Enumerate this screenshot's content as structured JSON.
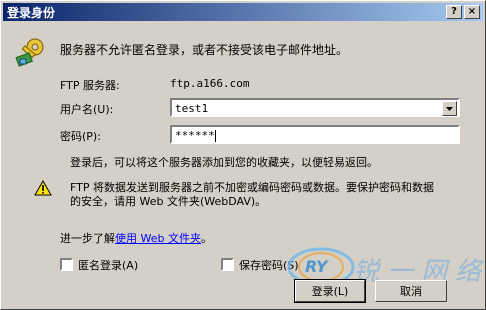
{
  "dialog": {
    "title": "登录身份",
    "help_button": "?",
    "close_button": "×"
  },
  "message": "服务器不允许匿名登录，或者不接受该电子邮件地址。",
  "ftp_server": {
    "label": "FTP 服务器:",
    "value": "ftp.a166.com"
  },
  "username": {
    "label": "用户名(U):",
    "value": "test1"
  },
  "password": {
    "label": "密码(P):",
    "value": "******"
  },
  "info_after_login": "登录后，可以将这个服务器添加到您的收藏夹，以便轻易返回。",
  "warning": {
    "line1": "FTP 将数据发送到服务器之前不加密或编码密码或数据。要保护密码和数据",
    "line2": "的安全，请用 Web 文件夹(WebDAV)。"
  },
  "learn_more": {
    "prefix": "进一步了解",
    "link": "使用 Web 文件夹",
    "suffix": "。"
  },
  "anonymous_checkbox": {
    "label": "匿名登录(A)",
    "checked": false
  },
  "save_password_checkbox": {
    "label": "保存密码(S)",
    "checked": false
  },
  "buttons": {
    "login": "登录(L)",
    "cancel": "取消"
  },
  "watermark": {
    "logo_text": "RY",
    "text": "锐一网络"
  }
}
